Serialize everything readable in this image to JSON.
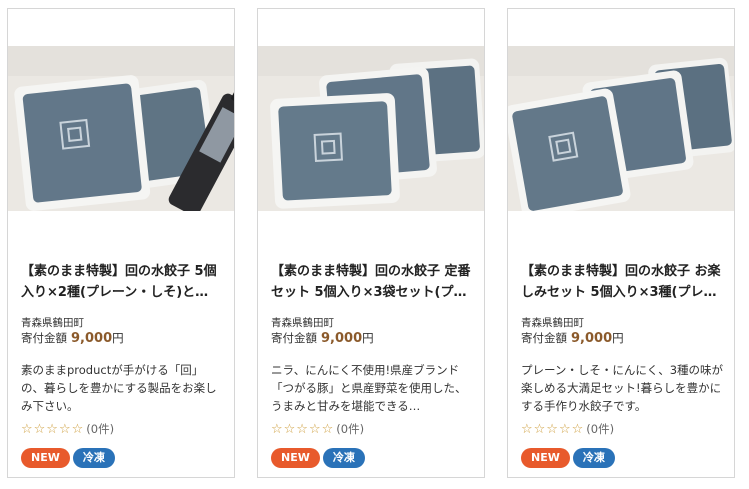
{
  "products": [
    {
      "title": "【素のまま特製】回の水餃子 5個入り×2種(プレーン・しそ)と…",
      "region": "青森県鶴田町",
      "price_label": "寄付金額",
      "price_value": "9,000",
      "price_unit": "円",
      "description": "素のままproductが手がける「回」の、暮らしを豊かにする製品をお楽しみ下さい。",
      "stars": "☆☆☆☆☆",
      "review_count": "(0件)",
      "badge_new": "NEW",
      "badge_frozen": "冷凍"
    },
    {
      "title": "【素のまま特製】回の水餃子 定番セット 5個入り×3袋セット(プ…",
      "region": "青森県鶴田町",
      "price_label": "寄付金額",
      "price_value": "9,000",
      "price_unit": "円",
      "description": "ニラ、にんにく不使用!県産ブランド「つがる豚」と県産野菜を使用した、うまみと甘みを堪能できる…",
      "stars": "☆☆☆☆☆",
      "review_count": "(0件)",
      "badge_new": "NEW",
      "badge_frozen": "冷凍"
    },
    {
      "title": "【素のまま特製】回の水餃子 お楽しみセット 5個入り×3種(プレ…",
      "region": "青森県鶴田町",
      "price_label": "寄付金額",
      "price_value": "9,000",
      "price_unit": "円",
      "description": "プレーン・しそ・にんにく、3種の味が楽しめる大満足セット!暮らしを豊かにする手作り水餃子です。",
      "stars": "☆☆☆☆☆",
      "review_count": "(0件)",
      "badge_new": "NEW",
      "badge_frozen": "冷凍"
    }
  ],
  "colors": {
    "price": "#8b5a2b",
    "star": "#cfa040",
    "badge_new": "#e85a2c",
    "badge_frozen": "#2a72b8",
    "package": "#5f7484"
  }
}
